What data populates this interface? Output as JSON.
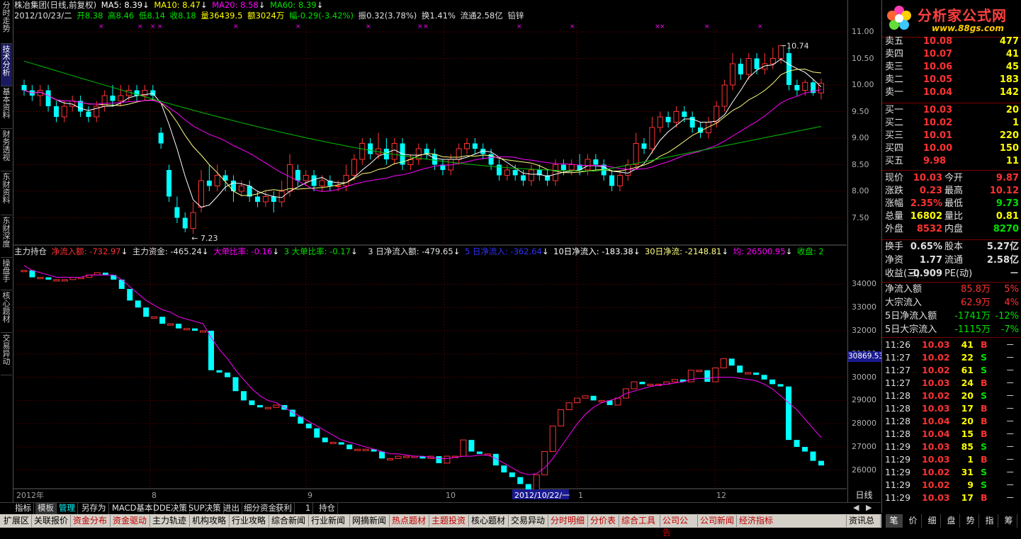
{
  "left_tabs": [
    "分时走势",
    "技术分析",
    "基本资料",
    "财务透视",
    "东财资料",
    "东财深度",
    "操盘手",
    "核心题材",
    "交易异动"
  ],
  "left_tab_active": 1,
  "top_info": {
    "stock": "株冶集团(日线,前复权)",
    "ma5": "MA5: 8.39",
    "ma10": "MA10: 8.47",
    "ma20": "MA20: 8.58",
    "ma60": "MA60: 8.39",
    "date": "2012/10/23/二",
    "open": "开8.38",
    "high": "高8.46",
    "low": "低8.14",
    "close": "收8.18",
    "vol": "量36439.5",
    "amount": "额3024万",
    "change": "幅-0.29(-3.42%)",
    "amp": "振0.32(3.78%)",
    "turnover": "换1.41%",
    "float": "流通2.58亿",
    "industry": "铅锌",
    "arrow": "↓"
  },
  "mid_info": {
    "name": "主力持仓",
    "i1": "净流入额: -732.97",
    "i2": "主力资金: -465.24",
    "i3": "大单比率: -0.16",
    "i4": "3 大单比率: -0.17",
    "i5": "3 日净流入额: -479.65",
    "i6": "5 日净流入: -362.64",
    "i7": "10日净流入: -183.38",
    "i8": "30日净流: -2148.81",
    "i9": "均: 26500.95",
    "i10": "收盘: 2",
    "arrow": "↓"
  },
  "colors": {
    "up": "#ff3232",
    "down": "#00ffff",
    "white": "#ffffff",
    "ma20": "#ff00ff",
    "ma60": "#00c000",
    "yellow": "#ffff00",
    "green": "#00e000",
    "grid": "#7a0000"
  },
  "price_axis": [
    "11.00",
    "10.50",
    "10.00",
    "9.50",
    "9.00",
    "8.50",
    "8.00",
    "7.50"
  ],
  "fund_axis": [
    "34000",
    "33000",
    "32000",
    "31000",
    "30000",
    "29000",
    "28000",
    "27000",
    "26000"
  ],
  "fund_current": "30869.53",
  "annotations": {
    "high": "10.74",
    "low": "7.23"
  },
  "x_labels": [
    "2012年",
    "8",
    "9",
    "10",
    "2012/10/22/一",
    "1",
    "12"
  ],
  "period_label": "日线",
  "price_chart": {
    "ylim": [
      7.0,
      11.2
    ],
    "candles": [
      [
        10.0,
        9.9,
        10.1,
        9.8
      ],
      [
        9.9,
        9.8,
        10.0,
        9.7
      ],
      [
        9.8,
        9.9,
        10.0,
        9.6
      ],
      [
        9.9,
        9.6,
        10.0,
        9.5
      ],
      [
        9.6,
        9.4,
        9.7,
        9.3
      ],
      [
        9.4,
        9.6,
        9.7,
        9.3
      ],
      [
        9.6,
        9.7,
        9.8,
        9.5
      ],
      [
        9.7,
        9.5,
        9.8,
        9.4
      ],
      [
        9.5,
        9.4,
        9.6,
        9.3
      ],
      [
        9.4,
        9.6,
        9.7,
        9.3
      ],
      [
        9.6,
        9.8,
        9.9,
        9.5
      ],
      [
        9.8,
        9.7,
        10.0,
        9.6
      ],
      [
        9.7,
        9.8,
        10.0,
        9.6
      ],
      [
        9.8,
        9.9,
        10.0,
        9.7
      ],
      [
        9.9,
        9.8,
        10.0,
        9.7
      ],
      [
        9.8,
        9.9,
        10.0,
        9.7
      ],
      [
        9.9,
        9.8,
        10.0,
        9.7
      ],
      [
        9.1,
        8.9,
        9.2,
        8.8
      ],
      [
        8.4,
        7.9,
        8.5,
        7.8
      ],
      [
        7.7,
        7.5,
        7.9,
        7.4
      ],
      [
        7.5,
        7.3,
        7.6,
        7.23
      ],
      [
        7.3,
        7.6,
        7.8,
        7.2
      ],
      [
        7.7,
        8.2,
        8.4,
        7.6
      ],
      [
        8.2,
        8.1,
        8.5,
        8.0
      ],
      [
        8.1,
        8.3,
        8.5,
        8.0
      ],
      [
        8.3,
        8.2,
        8.4,
        8.0
      ],
      [
        8.2,
        8.0,
        8.3,
        7.8
      ],
      [
        8.0,
        8.1,
        8.2,
        7.9
      ],
      [
        8.1,
        7.9,
        8.2,
        7.8
      ],
      [
        7.9,
        7.8,
        8.0,
        7.7
      ],
      [
        7.8,
        7.9,
        8.0,
        7.7
      ],
      [
        7.9,
        7.8,
        8.0,
        7.6
      ],
      [
        7.8,
        8.0,
        8.2,
        7.7
      ],
      [
        8.0,
        8.5,
        8.7,
        7.9
      ],
      [
        8.4,
        8.2,
        8.5,
        8.1
      ],
      [
        8.2,
        8.3,
        8.4,
        8.1
      ],
      [
        8.3,
        8.1,
        8.4,
        8.0
      ],
      [
        8.1,
        8.2,
        8.3,
        8.0
      ],
      [
        8.2,
        8.1,
        8.3,
        8.0
      ],
      [
        8.1,
        8.1,
        8.2,
        8.0
      ],
      [
        8.1,
        8.3,
        8.5,
        8.0
      ],
      [
        8.3,
        8.6,
        8.7,
        8.2
      ],
      [
        8.6,
        8.9,
        9.0,
        8.5
      ],
      [
        8.9,
        8.7,
        9.0,
        8.6
      ],
      [
        8.7,
        8.8,
        9.1,
        8.6
      ],
      [
        8.8,
        8.6,
        9.0,
        8.5
      ],
      [
        8.6,
        8.9,
        9.0,
        8.5
      ],
      [
        8.9,
        8.5,
        9.0,
        8.4
      ],
      [
        8.5,
        8.6,
        8.7,
        8.4
      ],
      [
        8.6,
        8.8,
        8.9,
        8.5
      ],
      [
        8.8,
        8.7,
        8.9,
        8.6
      ],
      [
        8.7,
        8.5,
        8.8,
        8.4
      ],
      [
        8.5,
        8.4,
        8.6,
        8.3
      ],
      [
        8.4,
        8.6,
        8.7,
        8.3
      ],
      [
        8.6,
        8.8,
        8.9,
        8.5
      ],
      [
        8.8,
        8.9,
        9.0,
        8.7
      ],
      [
        8.9,
        8.8,
        9.0,
        8.7
      ],
      [
        8.8,
        8.7,
        8.9,
        8.6
      ],
      [
        8.7,
        8.5,
        8.8,
        8.4
      ],
      [
        8.5,
        8.3,
        8.6,
        8.2
      ],
      [
        8.3,
        8.4,
        8.5,
        8.2
      ],
      [
        8.4,
        8.3,
        8.5,
        8.2
      ],
      [
        8.3,
        8.2,
        8.4,
        8.1
      ],
      [
        8.2,
        8.4,
        8.5,
        8.1
      ],
      [
        8.4,
        8.3,
        8.5,
        8.2
      ],
      [
        8.3,
        8.2,
        8.4,
        8.1
      ],
      [
        8.2,
        8.5,
        8.6,
        8.1
      ],
      [
        8.5,
        8.4,
        8.6,
        8.3
      ],
      [
        8.4,
        8.5,
        8.6,
        8.3
      ],
      [
        8.5,
        8.4,
        8.7,
        8.3
      ],
      [
        8.4,
        8.6,
        8.7,
        8.3
      ],
      [
        8.6,
        8.5,
        8.7,
        8.4
      ],
      [
        8.5,
        8.3,
        8.6,
        8.2
      ],
      [
        8.3,
        8.1,
        8.4,
        8.0
      ],
      [
        8.1,
        8.3,
        8.4,
        8.0
      ],
      [
        8.3,
        8.5,
        8.6,
        8.2
      ],
      [
        8.5,
        8.9,
        9.1,
        8.4
      ],
      [
        8.9,
        8.8,
        9.0,
        8.7
      ],
      [
        8.8,
        9.2,
        9.4,
        8.7
      ],
      [
        9.2,
        9.4,
        9.5,
        9.1
      ],
      [
        9.4,
        9.3,
        9.5,
        9.2
      ],
      [
        9.3,
        9.5,
        9.6,
        9.2
      ],
      [
        9.5,
        9.4,
        9.6,
        9.3
      ],
      [
        9.4,
        9.2,
        9.5,
        9.1
      ],
      [
        9.2,
        9.1,
        9.3,
        9.0
      ],
      [
        9.1,
        9.3,
        9.4,
        9.0
      ],
      [
        9.3,
        9.6,
        9.7,
        9.2
      ],
      [
        9.6,
        10.0,
        10.1,
        9.5
      ],
      [
        10.0,
        10.4,
        10.6,
        9.9
      ],
      [
        10.4,
        10.2,
        10.5,
        10.1
      ],
      [
        10.2,
        10.5,
        10.6,
        10.1
      ],
      [
        10.5,
        10.3,
        10.6,
        10.2
      ],
      [
        10.3,
        10.4,
        10.6,
        10.2
      ],
      [
        10.4,
        10.5,
        10.7,
        10.3
      ],
      [
        10.5,
        10.74,
        10.74,
        10.4
      ],
      [
        10.6,
        10.0,
        10.7,
        9.9
      ],
      [
        10.0,
        9.9,
        10.1,
        9.8
      ],
      [
        9.9,
        10.05,
        10.1,
        9.8
      ],
      [
        10.05,
        9.85,
        10.1,
        9.8
      ],
      [
        9.85,
        10.03,
        10.12,
        9.73
      ]
    ]
  },
  "fund_chart": {
    "ylim": [
      25200,
      35200
    ],
    "values": [
      34600,
      34300,
      34300,
      34200,
      34200,
      34200,
      34300,
      34300,
      34400,
      34500,
      34400,
      34200,
      33800,
      33300,
      33000,
      32600,
      32600,
      32300,
      32300,
      32100,
      32100,
      32000,
      32000,
      30300,
      30200,
      30000,
      29400,
      29000,
      28800,
      28700,
      28700,
      28800,
      28600,
      28300,
      28000,
      27800,
      27400,
      27200,
      27200,
      27100,
      26900,
      26900,
      26900,
      26800,
      26500,
      26500,
      26600,
      26600,
      26600,
      26500,
      26600,
      26300,
      26600,
      26600,
      27300,
      26800,
      26700,
      26700,
      26200,
      25900,
      25700,
      25400,
      24900,
      25800,
      26800,
      27900,
      28600,
      28900,
      29100,
      29200,
      29000,
      29000,
      28800,
      29100,
      29500,
      29800,
      29700,
      29700,
      29700,
      29800,
      29900,
      29800,
      30300,
      30300,
      29800,
      30400,
      30800,
      30500,
      30200,
      30200,
      30100,
      29900,
      29700,
      29600,
      27300,
      27000,
      26800,
      26400,
      26200
    ],
    "ma": [
      34800,
      34600,
      34500,
      34400,
      34300,
      34300,
      34300,
      34300,
      34400,
      34400,
      34400,
      34400,
      34200,
      33900,
      33600,
      33300,
      33100,
      32900,
      32800,
      32600,
      32500,
      32400,
      32300,
      31700,
      31200,
      30800,
      30300,
      29900,
      29500,
      29200,
      29000,
      28900,
      28700,
      28500,
      28300,
      28100,
      27900,
      27700,
      27500,
      27300,
      27200,
      27100,
      27000,
      26900,
      26800,
      26700,
      26700,
      26650,
      26600,
      26600,
      26550,
      26500,
      26500,
      26550,
      26600,
      26600,
      26650,
      26650,
      26500,
      26300,
      26100,
      25900,
      25800,
      25850,
      26100,
      26500,
      27000,
      27500,
      28000,
      28400,
      28700,
      28900,
      29000,
      29100,
      29300,
      29400,
      29500,
      29600,
      29650,
      29700,
      29750,
      29800,
      29900,
      29950,
      29950,
      30000,
      30000,
      30000,
      29950,
      29900,
      29850,
      29700,
      29500,
      29200,
      28900,
      28600,
      28200,
      27800,
      27400
    ]
  },
  "quotes": {
    "sell": [
      [
        "卖五",
        "10.08",
        "477"
      ],
      [
        "卖四",
        "10.07",
        "41"
      ],
      [
        "卖三",
        "10.06",
        "45"
      ],
      [
        "卖二",
        "10.05",
        "183"
      ],
      [
        "卖一",
        "10.04",
        "142"
      ]
    ],
    "buy": [
      [
        "买一",
        "10.03",
        "20"
      ],
      [
        "买二",
        "10.02",
        "1"
      ],
      [
        "买三",
        "10.01",
        "220"
      ],
      [
        "买四",
        "10.00",
        "150"
      ],
      [
        "买五",
        "9.98",
        "11"
      ]
    ],
    "stats": [
      [
        "现价",
        "10.03",
        "今开",
        "9.87"
      ],
      [
        "涨跌",
        "0.23",
        "最高",
        "10.12"
      ],
      [
        "涨幅",
        "2.35%",
        "最低",
        "9.73"
      ],
      [
        "总量",
        "16802",
        "量比",
        "0.81"
      ],
      [
        "外盘",
        "8532",
        "内盘",
        "8270"
      ]
    ],
    "stats2": [
      [
        "换手",
        "0.65%",
        "股本",
        "5.27亿"
      ],
      [
        "净资",
        "1.77",
        "流通",
        "2.58亿"
      ],
      [
        "收益(三)",
        "-0.909",
        "PE(动)",
        "－"
      ]
    ],
    "flows": [
      [
        "净流入额",
        "85.8万",
        "5%"
      ],
      [
        "大宗流入",
        "62.9万",
        "4%"
      ],
      [
        "5日净流入额",
        "-1741万",
        "-12%"
      ],
      [
        "5日大宗流入",
        "-1115万",
        "-7%"
      ]
    ]
  },
  "trades": [
    [
      "11:26",
      "10.03",
      "41",
      "B"
    ],
    [
      "11:27",
      "10.02",
      "22",
      "S"
    ],
    [
      "11:27",
      "10.02",
      "61",
      "S"
    ],
    [
      "11:27",
      "10.03",
      "24",
      "B"
    ],
    [
      "11:28",
      "10.02",
      "20",
      "S"
    ],
    [
      "11:28",
      "10.03",
      "17",
      "B"
    ],
    [
      "11:28",
      "10.04",
      "20",
      "B"
    ],
    [
      "11:28",
      "10.04",
      "15",
      "B"
    ],
    [
      "11:29",
      "10.03",
      "85",
      "S"
    ],
    [
      "11:29",
      "10.03",
      "1",
      "B"
    ],
    [
      "11:29",
      "10.02",
      "31",
      "S"
    ],
    [
      "11:29",
      "10.02",
      "9",
      "S"
    ],
    [
      "11:29",
      "10.03",
      "17",
      "B"
    ]
  ],
  "dash": "－",
  "bottom_tabs": [
    "指标",
    "模板",
    "管理",
    "另存为",
    "MACD基本",
    "DDE决策",
    "SUP决策",
    "进出",
    "细分资金",
    "获利",
    "1",
    "持仓"
  ],
  "menu": [
    "扩展区",
    "关联报价",
    "资金分布",
    "资金驱动",
    "主力轨迹",
    "机构攻略",
    "行业攻略",
    "综合新闻",
    "行业新闻",
    "网摘新闻",
    "热点题材",
    "主题投资",
    "核心题材",
    "交易异动",
    "分时明细",
    "分价表",
    "综合工具",
    "公司公告",
    "公司新闻",
    "经济指标",
    "资讯总览"
  ],
  "right_tabs": [
    "笔",
    "价",
    "细",
    "盘",
    "势",
    "指",
    "筹"
  ],
  "logo": {
    "title": "分析家公式网",
    "url": "www.88gs.com"
  }
}
